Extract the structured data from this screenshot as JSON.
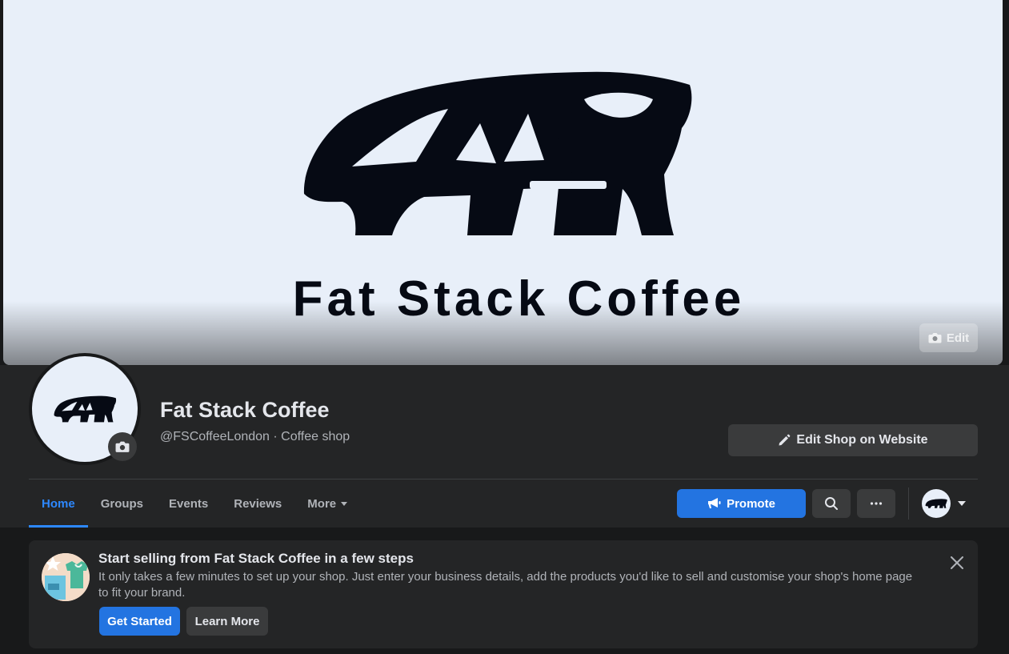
{
  "cover": {
    "title": "Fat Stack Coffee",
    "edit_label": "Edit"
  },
  "profile": {
    "name": "Fat Stack Coffee",
    "subtitle": "@FSCoffeeLondon · Coffee shop",
    "edit_shop_label": "Edit Shop on Website"
  },
  "tabs": [
    {
      "label": "Home",
      "active": true
    },
    {
      "label": "Groups",
      "active": false
    },
    {
      "label": "Events",
      "active": false
    },
    {
      "label": "Reviews",
      "active": false
    },
    {
      "label": "More",
      "active": false
    }
  ],
  "actions": {
    "promote_label": "Promote"
  },
  "shop_card": {
    "title": "Start selling from Fat Stack Coffee in a few steps",
    "text": "It only takes a few minutes to set up your shop. Just enter your business details, add the products you'd like to sell and customise your shop's home page to fit your brand.",
    "get_started_label": "Get Started",
    "learn_more_label": "Learn More"
  },
  "colors": {
    "accent": "#2374e1",
    "active_tab": "#2d88ff",
    "surface": "#242526",
    "background": "#18191a",
    "button": "#3a3b3c",
    "cover_bg": "#e8eff9"
  }
}
